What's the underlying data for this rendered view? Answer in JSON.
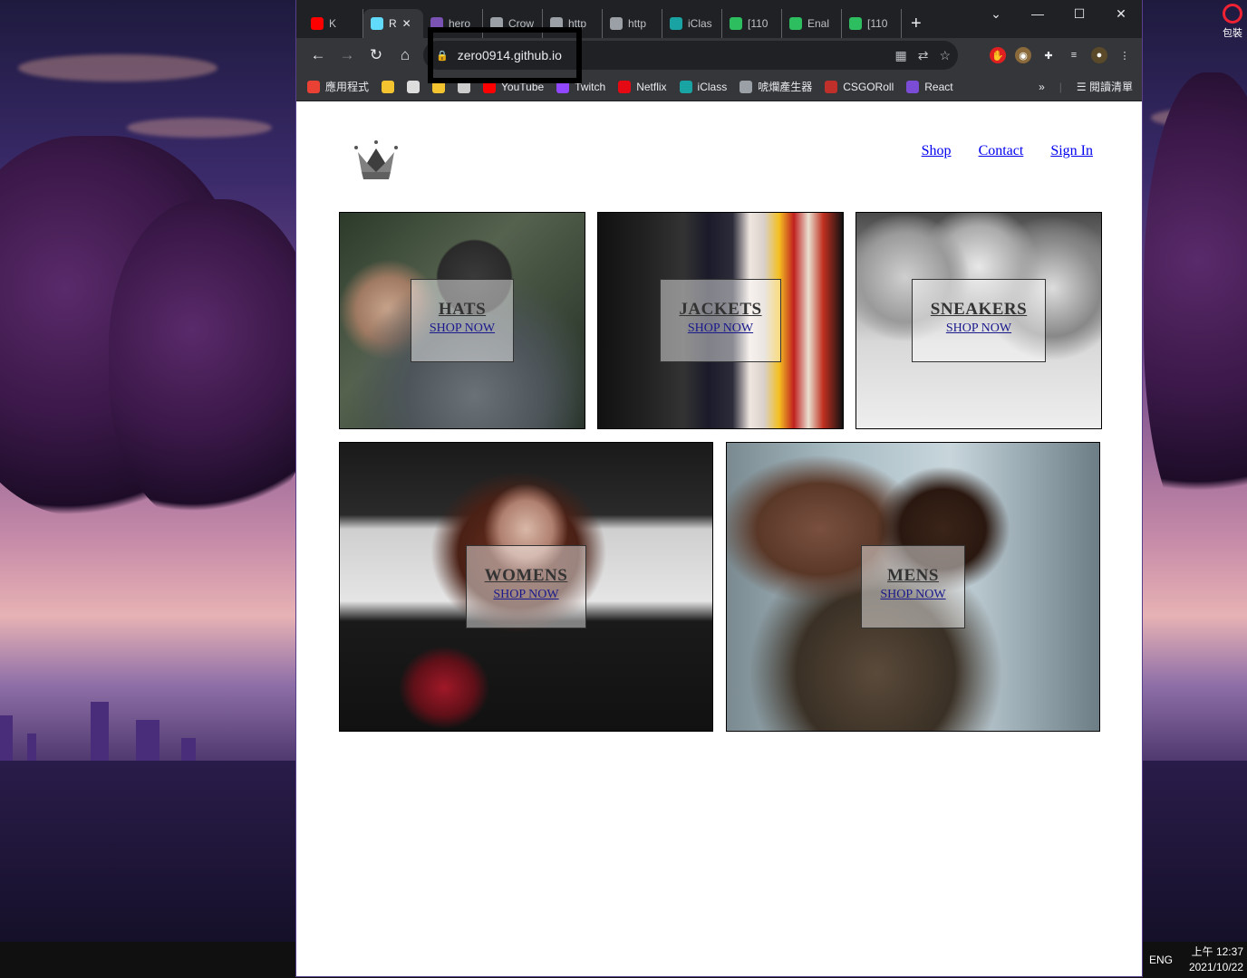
{
  "browser": {
    "tabs": [
      {
        "label": "K",
        "icon": "youtube-icon",
        "color": "#ff0000"
      },
      {
        "label": "R",
        "icon": "react-icon",
        "color": "#61dafb",
        "active": true
      },
      {
        "label": "hero",
        "icon": "heroku-icon",
        "color": "#7952b3"
      },
      {
        "label": "Crow",
        "icon": "globe-icon",
        "color": "#9aa0a6"
      },
      {
        "label": "http",
        "icon": "globe-icon",
        "color": "#9aa0a6"
      },
      {
        "label": "http",
        "icon": "globe-icon",
        "color": "#9aa0a6"
      },
      {
        "label": "iClas",
        "icon": "iclass-icon",
        "color": "#1aa3a3"
      },
      {
        "label": "[110",
        "icon": "evernote-icon",
        "color": "#2dbe60"
      },
      {
        "label": "Enal",
        "icon": "evernote-icon",
        "color": "#2dbe60"
      },
      {
        "label": "[110",
        "icon": "evernote-icon",
        "color": "#2dbe60"
      }
    ],
    "url": "zero0914.github.io",
    "bookmarks": [
      {
        "label": "應用程式",
        "icon": "apps-grid-icon"
      },
      {
        "label": "",
        "icon": "folder-icon"
      },
      {
        "label": "",
        "icon": "smile-icon"
      },
      {
        "label": "",
        "icon": "folder-icon"
      },
      {
        "label": "",
        "icon": "bug-icon"
      },
      {
        "label": "YouTube",
        "icon": "youtube-icon"
      },
      {
        "label": "Twitch",
        "icon": "twitch-icon"
      },
      {
        "label": "Netflix",
        "icon": "netflix-icon"
      },
      {
        "label": "iClass",
        "icon": "iclass-icon"
      },
      {
        "label": "唬爛產生器",
        "icon": "globe-icon"
      },
      {
        "label": "CSGORoll",
        "icon": "csgoroll-icon"
      },
      {
        "label": "React",
        "icon": "react-icon"
      }
    ],
    "more_bookmarks": "»",
    "reading_list": "閱讀清單"
  },
  "page": {
    "nav": {
      "shop": "Shop",
      "contact": "Contact",
      "signin": "Sign In"
    },
    "categories": [
      {
        "title": "HATS",
        "sub": "SHOP NOW"
      },
      {
        "title": "JACKETS",
        "sub": "SHOP NOW"
      },
      {
        "title": "SNEAKERS",
        "sub": "SHOP NOW"
      },
      {
        "title": "WOMENS",
        "sub": "SHOP NOW"
      },
      {
        "title": "MENS",
        "sub": "SHOP NOW"
      }
    ]
  },
  "desktop": {
    "icon_label": "包裝",
    "tray": {
      "lang": "ENG",
      "time": "上午 12:37",
      "date": "2021/10/22"
    }
  }
}
